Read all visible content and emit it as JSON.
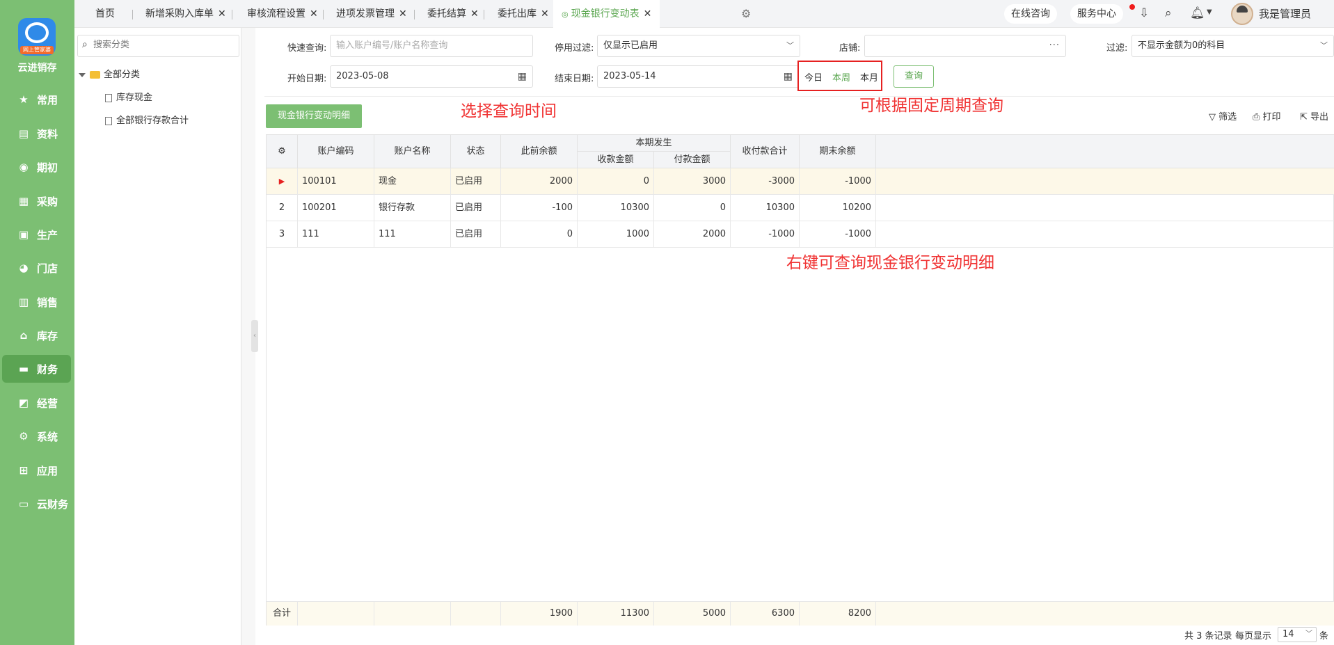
{
  "app": {
    "brand": "云进销存",
    "logo_badge": "网上管家婆"
  },
  "nav": [
    {
      "label": "常用",
      "icon": "star-icon"
    },
    {
      "label": "资料",
      "icon": "document-icon"
    },
    {
      "label": "期初",
      "icon": "target-icon"
    },
    {
      "label": "采购",
      "icon": "purchase-icon"
    },
    {
      "label": "生产",
      "icon": "production-icon"
    },
    {
      "label": "门店",
      "icon": "pie-icon"
    },
    {
      "label": "销售",
      "icon": "sales-icon"
    },
    {
      "label": "库存",
      "icon": "warehouse-icon"
    },
    {
      "label": "财务",
      "icon": "finance-icon"
    },
    {
      "label": "经营",
      "icon": "chart-icon"
    },
    {
      "label": "系统",
      "icon": "settings-icon"
    },
    {
      "label": "应用",
      "icon": "plus-icon"
    },
    {
      "label": "云财务",
      "icon": "cloud-finance-icon"
    }
  ],
  "tabs": [
    {
      "label": "首页"
    },
    {
      "label": "新增采购入库单"
    },
    {
      "label": "审核流程设置"
    },
    {
      "label": "进项发票管理"
    },
    {
      "label": "委托结算"
    },
    {
      "label": "委托出库"
    },
    {
      "label": "现金银行变动表"
    }
  ],
  "header": {
    "consult": "在线咨询",
    "service": "服务中心",
    "user": "我是管理员"
  },
  "tree": {
    "search_placeholder": "搜索分类",
    "root": "全部分类",
    "children": [
      "库存现金",
      "全部银行存款合计"
    ]
  },
  "filters": {
    "quick_label": "快速查询:",
    "quick_placeholder": "输入账户编号/账户名称查询",
    "disabled_label": "停用过滤:",
    "disabled_value": "仅显示已启用",
    "store_label": "店铺:",
    "filter_label": "过滤:",
    "filter_value": "不显示金额为0的科目",
    "start_label": "开始日期:",
    "start_value": "2023-05-08",
    "end_label": "结束日期:",
    "end_value": "2023-05-14",
    "today": "今日",
    "week": "本周",
    "month": "本月",
    "query": "查询"
  },
  "toolbar": {
    "detail": "现金银行变动明细",
    "filter": "筛选",
    "print": "打印",
    "export": "导出"
  },
  "annotations": {
    "select_time": "选择查询时间",
    "fixed_period": "可根据固定周期查询",
    "right_click": "右键可查询现金银行变动明细"
  },
  "table": {
    "headers": {
      "code": "账户编码",
      "name": "账户名称",
      "status": "状态",
      "prev": "此前余额",
      "period": "本期发生",
      "receive": "收款金额",
      "pay": "付款金额",
      "total": "收付款合计",
      "end": "期末余额"
    },
    "rows": [
      {
        "idx": "▶",
        "code": "100101",
        "name": "现金",
        "status": "已启用",
        "prev": "2000",
        "receive": "0",
        "pay": "3000",
        "total": "-3000",
        "end": "-1000"
      },
      {
        "idx": "2",
        "code": "100201",
        "name": "银行存款",
        "status": "已启用",
        "prev": "-100",
        "receive": "10300",
        "pay": "0",
        "total": "10300",
        "end": "10200"
      },
      {
        "idx": "3",
        "code": "111",
        "name": "111",
        "status": "已启用",
        "prev": "0",
        "receive": "1000",
        "pay": "2000",
        "total": "-1000",
        "end": "-1000"
      }
    ],
    "footer": {
      "label": "合计",
      "prev": "1900",
      "receive": "11300",
      "pay": "5000",
      "total": "6300",
      "end": "8200"
    }
  },
  "pager": {
    "records": "共 3 条记录",
    "per_page": "每页显示",
    "size": "14",
    "unit": "条"
  }
}
